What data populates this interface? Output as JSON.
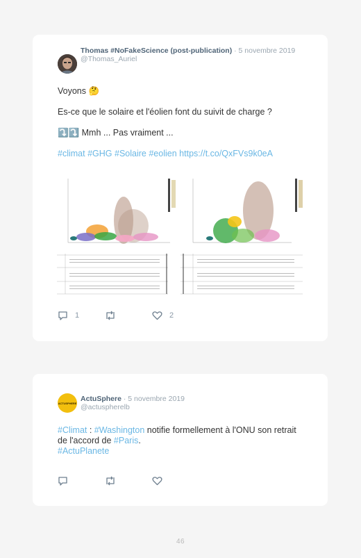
{
  "tweet1": {
    "author_name": "Thomas #NoFakeScience (post-publication)",
    "date": "5 novembre 2019",
    "handle": "@Thomas_Auriel",
    "line1": "Voyons 🤔",
    "line2": "Es-ce que le solaire et l'éolien font du suivit de charge ?",
    "line3_emoji": "⤵️⤵️",
    "line3": "Mmh ... Pas vraiment ...",
    "hashtags": [
      "#climat",
      "#GHG",
      "#Solaire",
      "#eolien"
    ],
    "link": "https://t.co/QxFVs9k0eA",
    "reply_count": "1",
    "like_count": "2"
  },
  "tweet2": {
    "author_name": "ActuSphere",
    "date": "5 novembre 2019",
    "handle": "@actuspherelb",
    "avatar_text": "ACTUSPHERE",
    "tag_climat": "#Climat",
    "sep": " : ",
    "tag_washington": "#Washington",
    "text_a": " notifie formellement à l'ONU son retrait de l'accord de ",
    "tag_paris": "#Paris",
    "text_b": ".",
    "tag_actuplanete": "#ActuPlanete"
  },
  "page_number": "46",
  "colors": {
    "hashtag": "#6ab7e4",
    "username": "#4f6477",
    "meta": "#9aa6b0"
  },
  "icons": [
    "reply-icon",
    "retweet-icon",
    "like-icon"
  ]
}
